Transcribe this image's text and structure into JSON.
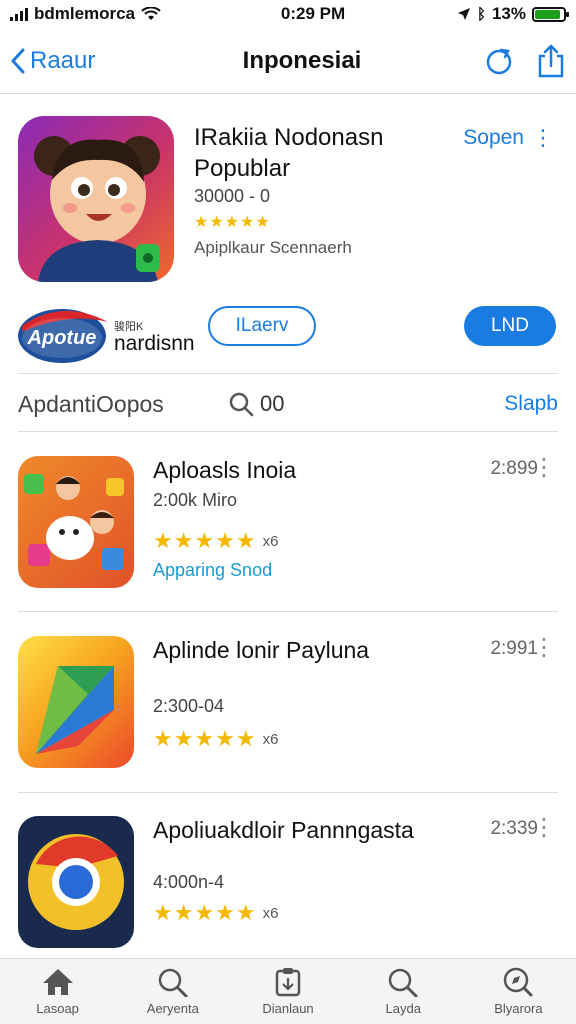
{
  "status_bar": {
    "carrier": "bdmlemorca",
    "time": "0:29 PM",
    "battery": "13%",
    "battery_level": 0.9,
    "icons": [
      "signal-icon",
      "wifi-icon",
      "location-icon",
      "bluetooth-icon",
      "battery-icon"
    ]
  },
  "nav": {
    "back_label": "Raaur",
    "title": "Inponesiai",
    "actions": [
      "refresh-icon",
      "share-icon"
    ]
  },
  "featured": {
    "title": "IRakiia Nodonasn Popublar",
    "subtitle": "30000 - 0",
    "stars": "★★★★★",
    "category": "Apiplkaur Scennaerh",
    "link_label": "Sopen",
    "brand_logo_text": "Apotue",
    "brand_caption": "骏阳K",
    "brand_name": "nardisnn",
    "outline_button": "ILaerv",
    "fill_button": "LND"
  },
  "section": {
    "title": "ApdantiOopos",
    "search_value": "00",
    "link_label": "Slapb"
  },
  "apps": [
    {
      "name": "Aploasls Inoia",
      "meta": "2:00k Miro",
      "stars": "★★★★★",
      "count": "x6",
      "category": "Apparing Snod",
      "price": "2:899",
      "icon": "kids-game-icon"
    },
    {
      "name": "Aplinde lonir Payluna",
      "meta": "2:300-04",
      "stars": "★★★★★",
      "count": "x6",
      "category": "",
      "price": "2:991",
      "icon": "play-store-icon"
    },
    {
      "name": "Apoliuakdloir Pannngasta",
      "meta": "4:000n-4",
      "stars": "★★★★★",
      "count": "x6",
      "category": "",
      "price": "2:339",
      "icon": "browser-icon"
    }
  ],
  "tabs": [
    {
      "label": "Lasoap",
      "icon": "home-icon"
    },
    {
      "label": "Aeryenta",
      "icon": "search-icon"
    },
    {
      "label": "Dianlaun",
      "icon": "download-icon"
    },
    {
      "label": "Layda",
      "icon": "search-icon"
    },
    {
      "label": "Blyarora",
      "icon": "explore-icon"
    }
  ],
  "colors": {
    "accent": "#1a7be0",
    "star": "#f5b800",
    "category_link": "#1a9bd0"
  }
}
